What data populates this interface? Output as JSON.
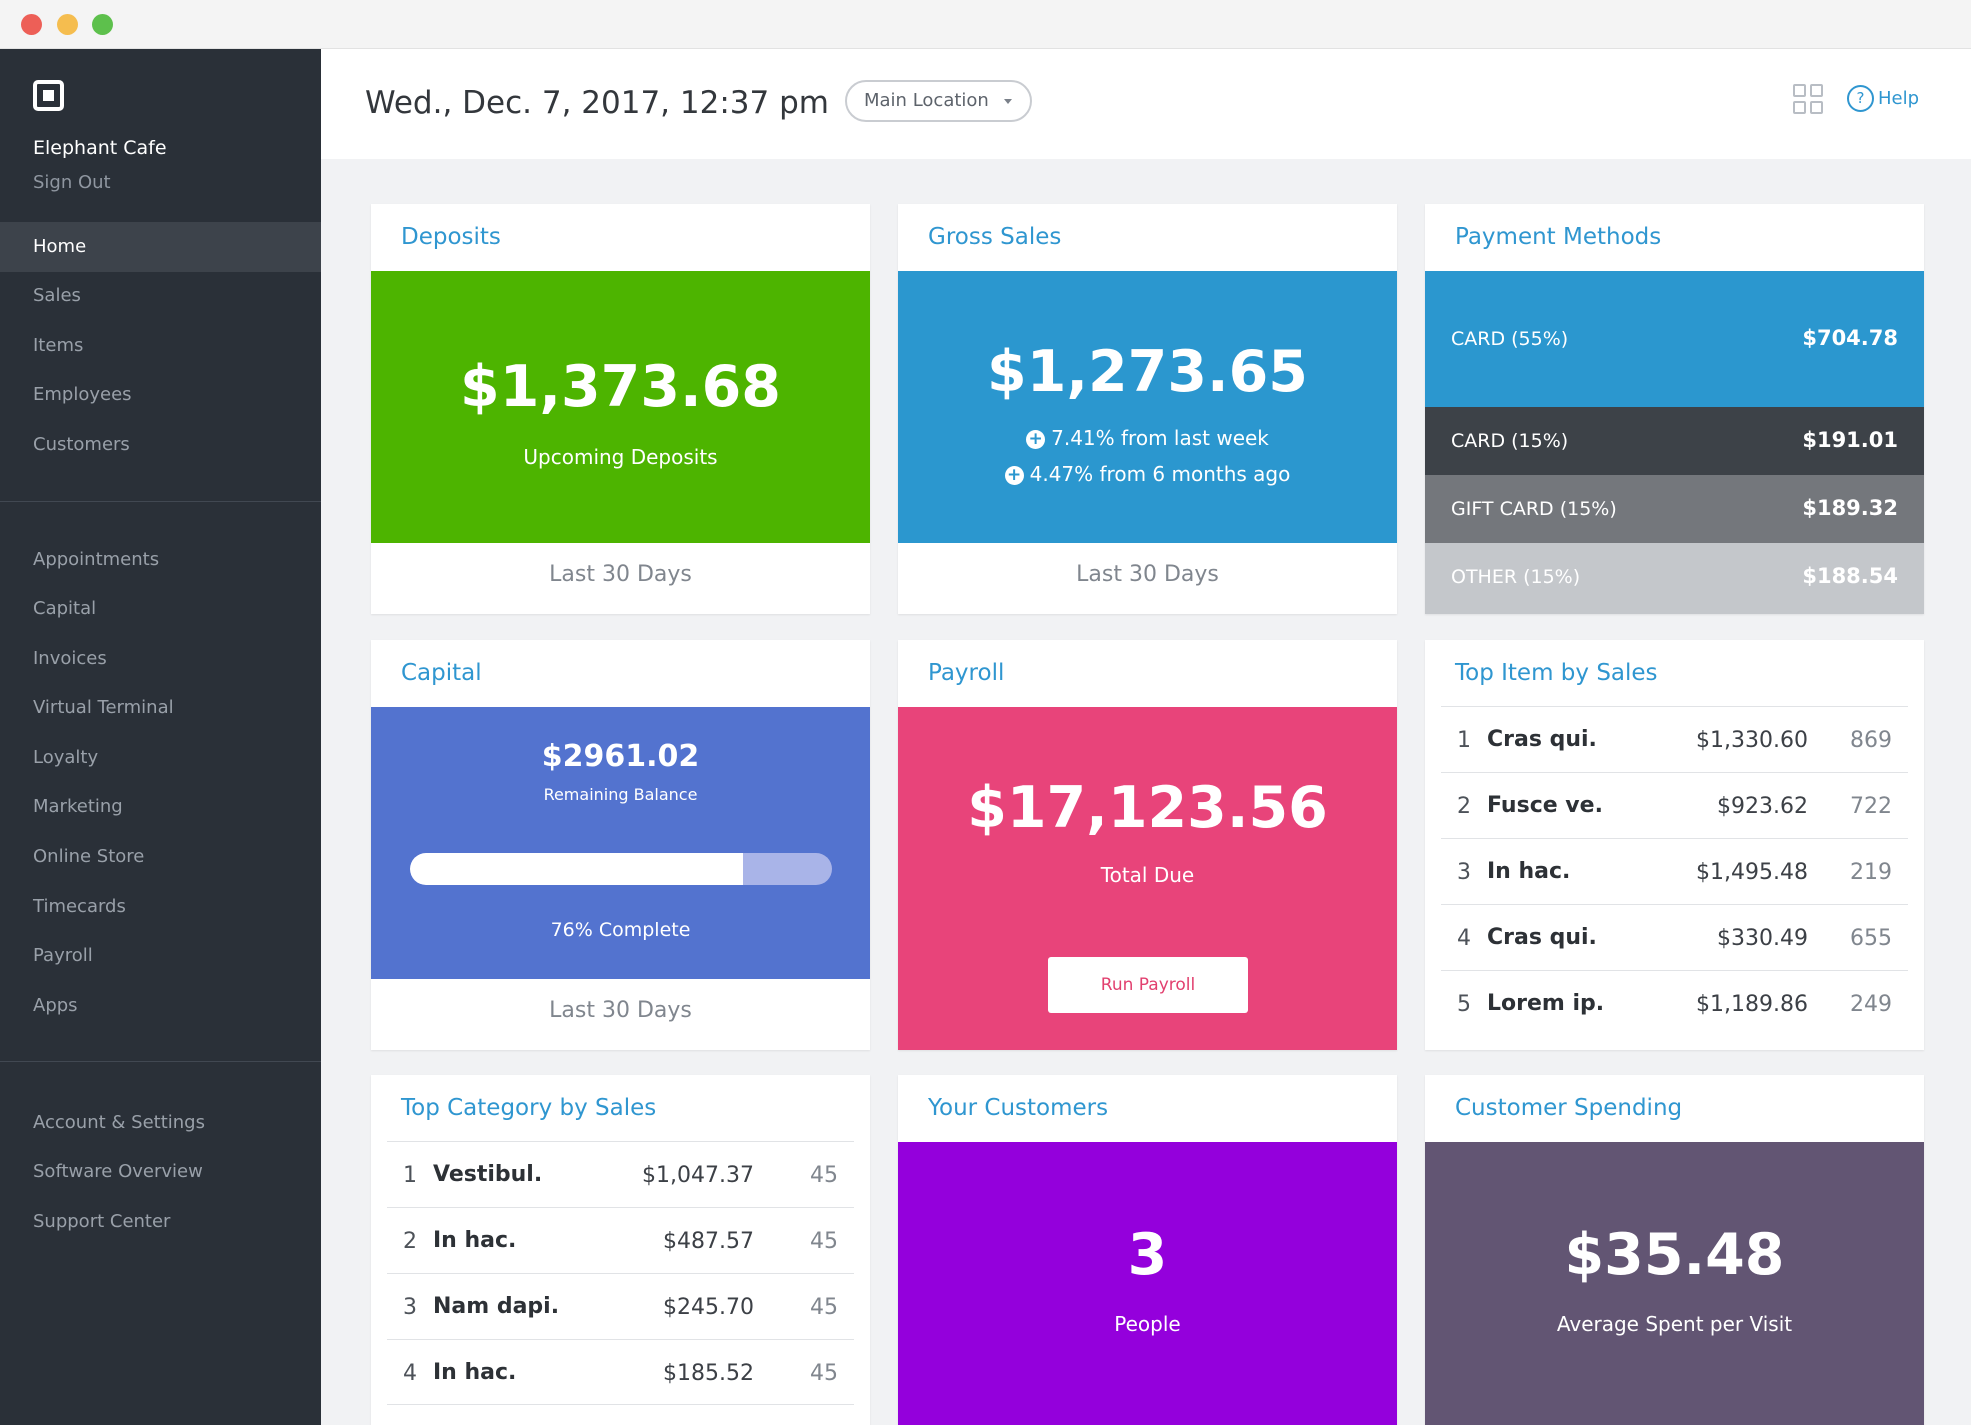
{
  "sidebar": {
    "business_name": "Elephant Cafe",
    "sign_out": "Sign Out",
    "primary_items": [
      "Home",
      "Sales",
      "Items",
      "Employees",
      "Customers"
    ],
    "secondary_items": [
      "Appointments",
      "Capital",
      "Invoices",
      "Virtual Terminal",
      "Loyalty",
      "Marketing",
      "Online Store",
      "Timecards",
      "Payroll",
      "Apps"
    ],
    "tertiary_items": [
      "Account & Settings",
      "Software Overview",
      "Support Center"
    ],
    "active_item": "Home"
  },
  "header": {
    "datetime": "Wed., Dec. 7, 2017, 12:37 pm",
    "location": "Main Location",
    "help_label": "Help",
    "help_icon_glyph": "?"
  },
  "deposits": {
    "title": "Deposits",
    "amount": "$1,373.68",
    "subtitle": "Upcoming Deposits",
    "footer": "Last 30 Days",
    "color": "#4db400"
  },
  "gross_sales": {
    "title": "Gross Sales",
    "amount": "$1,273.65",
    "change_week": "7.41% from last week",
    "change_6mo": "4.47% from 6 months ago",
    "footer": "Last 30 Days",
    "color": "#2b97cf"
  },
  "payment_methods": {
    "title": "Payment Methods",
    "rows": [
      {
        "label": "CARD (55%)",
        "value": "$704.78",
        "color": "#2b97cf"
      },
      {
        "label": "CARD (15%)",
        "value": "$191.01",
        "color": "#3d4248"
      },
      {
        "label": "GIFT CARD (15%)",
        "value": "$189.32",
        "color": "#74777c"
      },
      {
        "label": "OTHER (15%)",
        "value": "$188.54",
        "color": "#c4c7cb"
      }
    ]
  },
  "capital": {
    "title": "Capital",
    "balance": "$2961.02",
    "balance_label": "Remaining Balance",
    "progress_label": "76% Complete",
    "progress_fraction": 0.76,
    "footer": "Last 30 Days",
    "color": "#5373cf"
  },
  "payroll": {
    "title": "Payroll",
    "amount": "$17,123.56",
    "subtitle": "Total Due",
    "button": "Run Payroll",
    "color": "#e8447a"
  },
  "top_items": {
    "title": "Top Item by Sales",
    "rows": [
      {
        "rank": "1",
        "name": "Cras qui.",
        "amount": "$1,330.60",
        "count": "869"
      },
      {
        "rank": "2",
        "name": "Fusce ve.",
        "amount": "$923.62",
        "count": "722"
      },
      {
        "rank": "3",
        "name": "In hac.",
        "amount": "$1,495.48",
        "count": "219"
      },
      {
        "rank": "4",
        "name": "Cras qui.",
        "amount": "$330.49",
        "count": "655"
      },
      {
        "rank": "5",
        "name": "Lorem ip.",
        "amount": "$1,189.86",
        "count": "249"
      }
    ]
  },
  "top_categories": {
    "title": "Top Category by Sales",
    "rows": [
      {
        "rank": "1",
        "name": "Vestibul.",
        "amount": "$1,047.37",
        "count": "45"
      },
      {
        "rank": "2",
        "name": "In hac.",
        "amount": "$487.57",
        "count": "45"
      },
      {
        "rank": "3",
        "name": "Nam dapi.",
        "amount": "$245.70",
        "count": "45"
      },
      {
        "rank": "4",
        "name": "In hac.",
        "amount": "$185.52",
        "count": "45"
      }
    ]
  },
  "customers": {
    "title": "Your Customers",
    "count": "3",
    "label": "People",
    "color": "#9400dc"
  },
  "spending": {
    "title": "Customer Spending",
    "amount": "$35.48",
    "label": "Average Spent per Visit",
    "color": "#625573"
  }
}
